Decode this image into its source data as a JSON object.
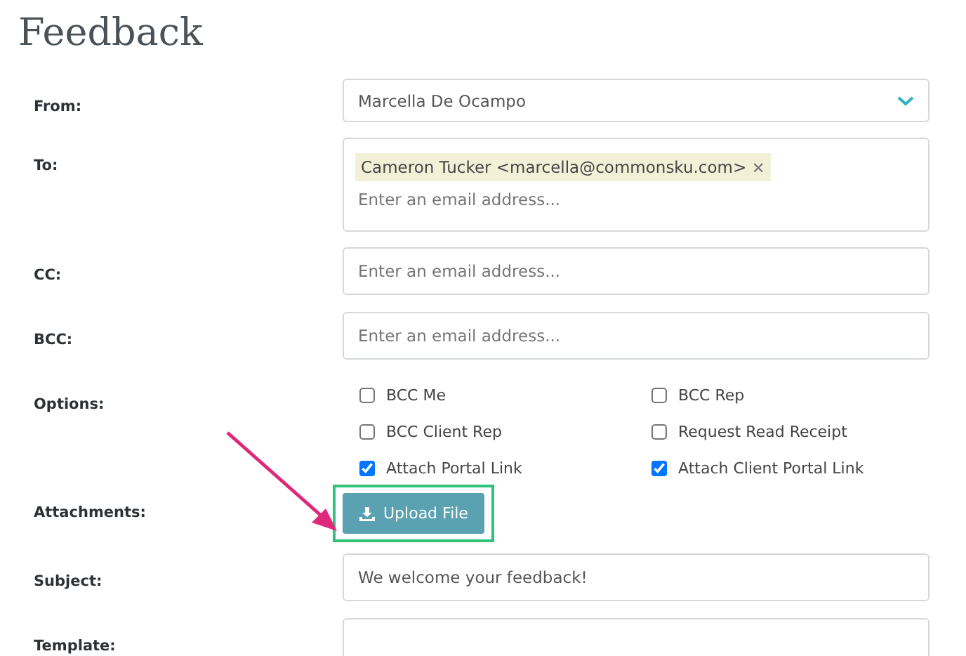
{
  "title": "Feedback",
  "rows": [
    {
      "kind": "select",
      "label": "From:",
      "value": "Marcella De Ocampo"
    },
    {
      "kind": "tags",
      "label": "To:",
      "tags": [
        "Cameron Tucker <marcella@commonsku.com>"
      ],
      "remove": "×",
      "placeholder": "Enter an email address..."
    },
    {
      "kind": "text",
      "label": "CC:",
      "placeholder": "Enter an email address..."
    },
    {
      "kind": "text",
      "label": "BCC:",
      "placeholder": "Enter an email address..."
    },
    {
      "kind": "options",
      "label": "Options:",
      "options": [
        {
          "label": "BCC Me",
          "checked": false
        },
        {
          "label": "BCC Rep",
          "checked": false
        },
        {
          "label": "BCC Client Rep",
          "checked": false
        },
        {
          "label": "Request Read Receipt",
          "checked": false
        },
        {
          "label": "Attach Portal Link",
          "checked": true
        },
        {
          "label": "Attach Client Portal Link",
          "checked": true
        }
      ]
    },
    {
      "kind": "upload",
      "label": "Attachments:",
      "button": "Upload File",
      "highlighted": true
    },
    {
      "kind": "text",
      "label": "Subject:",
      "value": "We welcome your feedback!"
    },
    {
      "kind": "text",
      "label": "Template:"
    }
  ]
}
